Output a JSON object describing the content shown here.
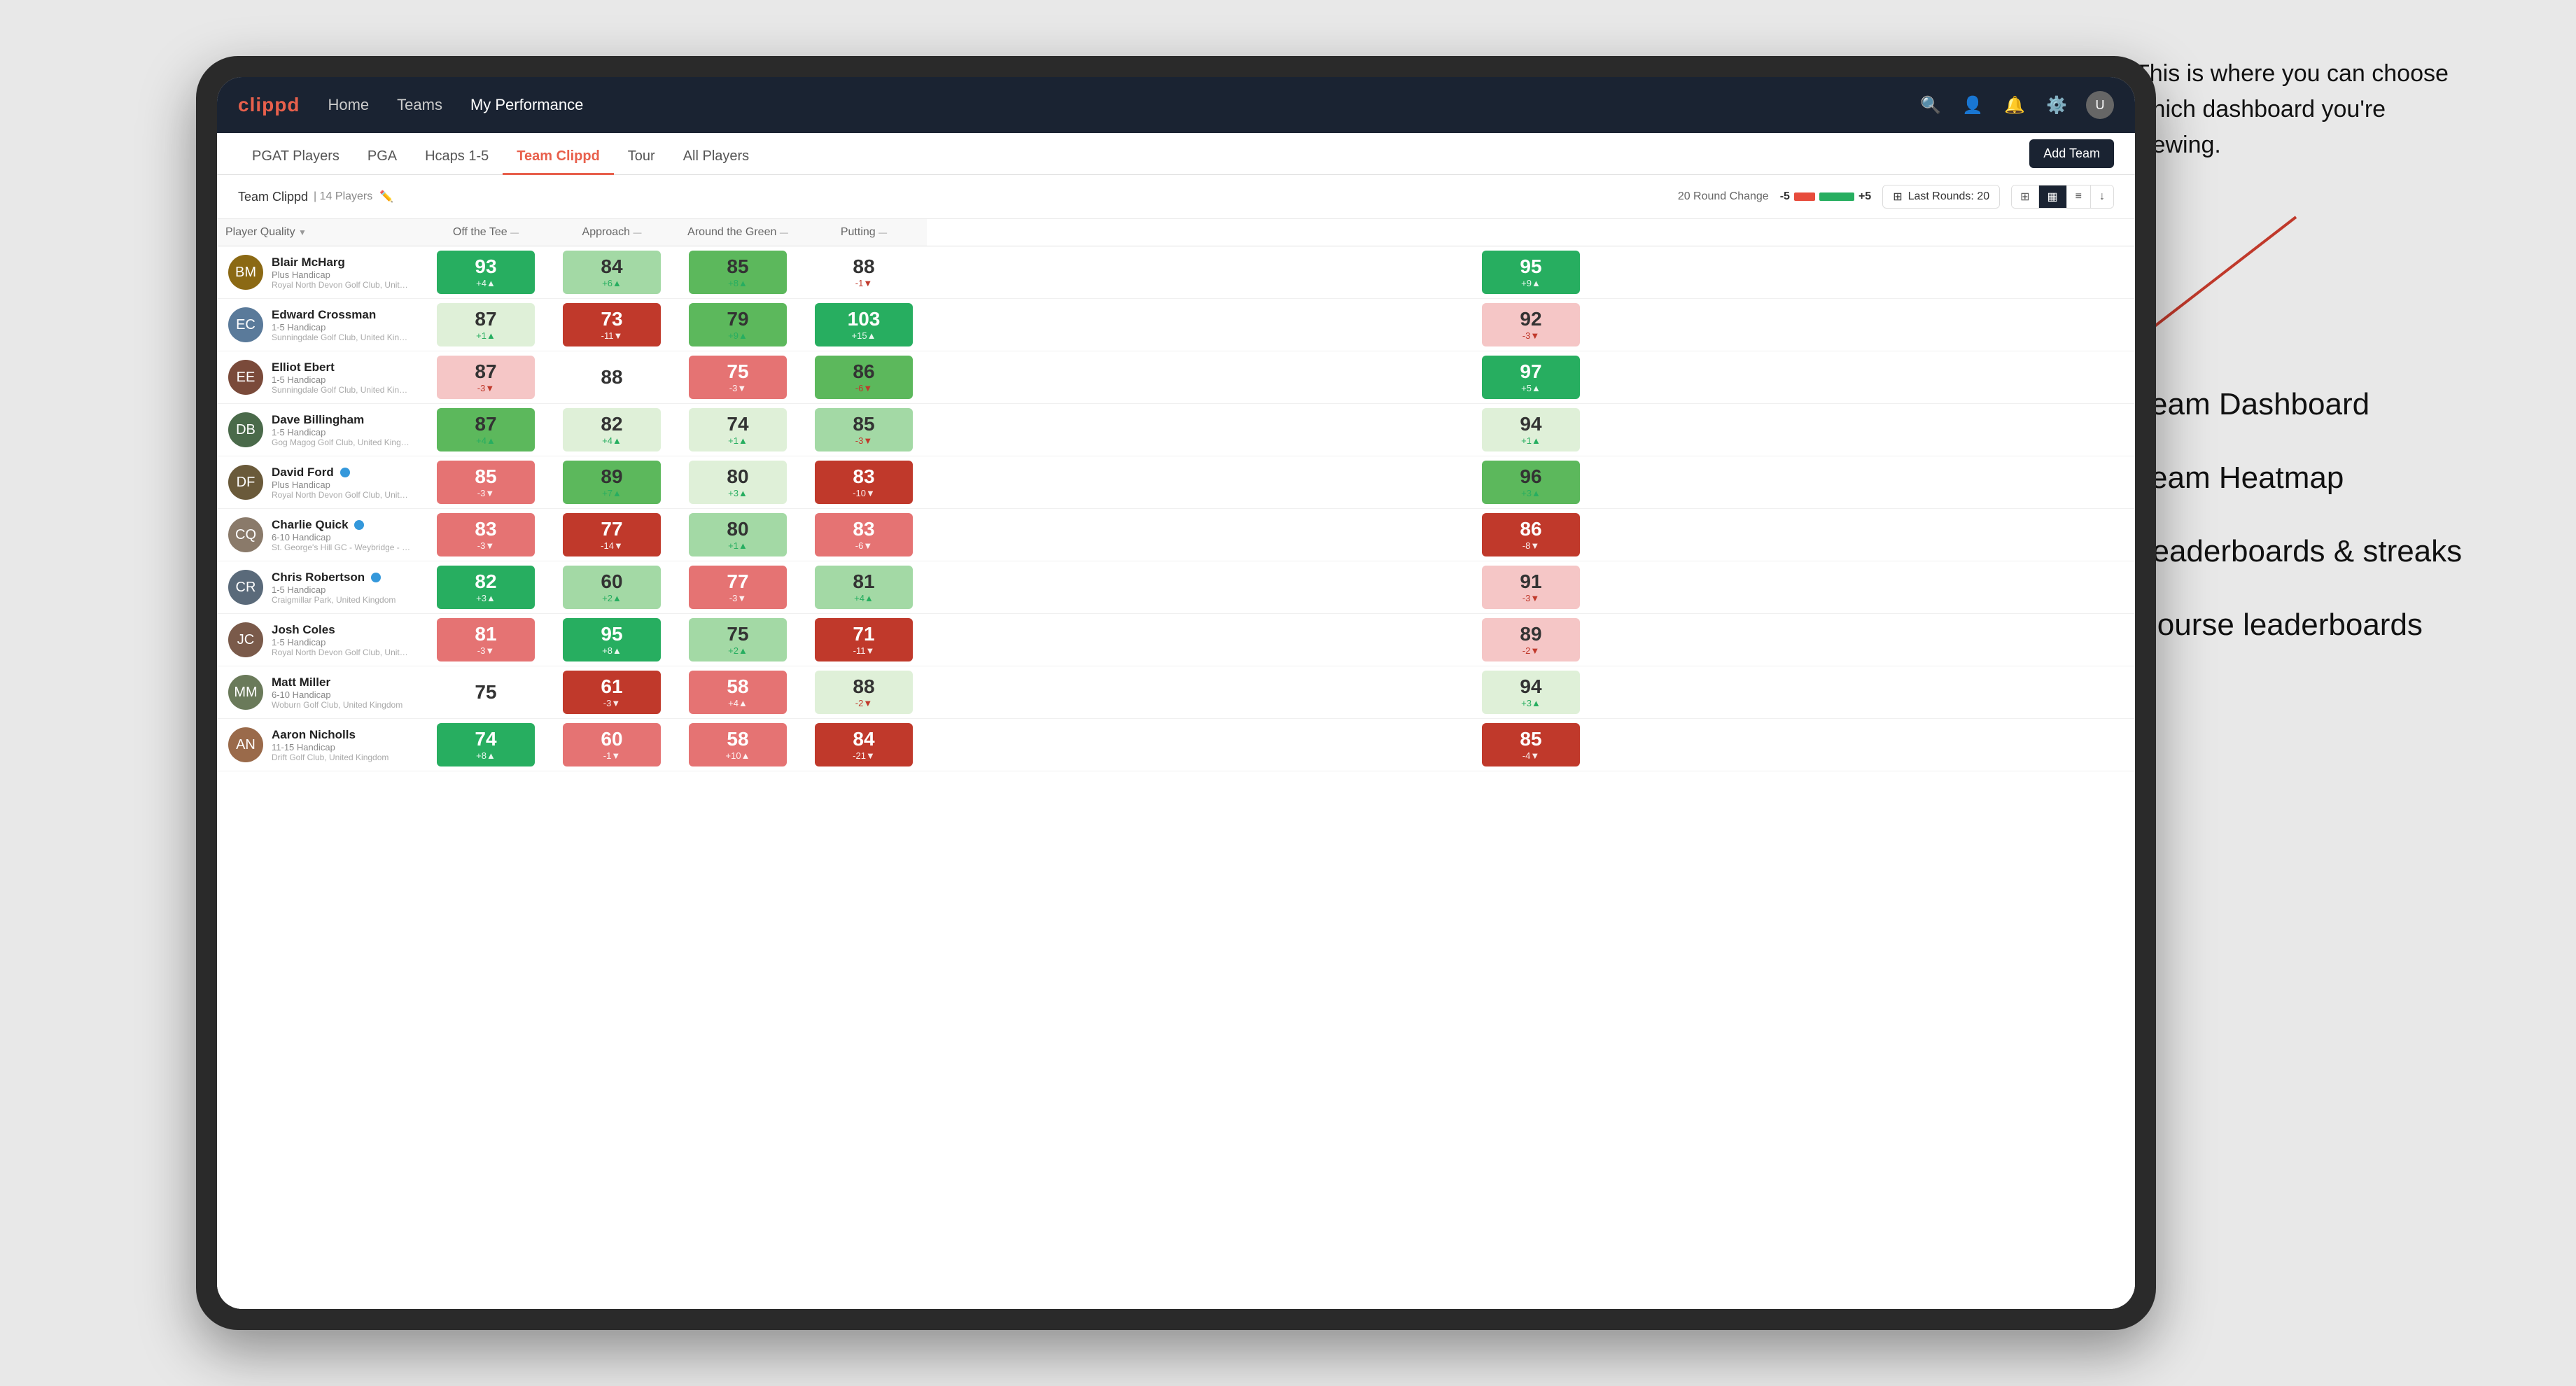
{
  "annotation": {
    "callout": "This is where you can choose which dashboard you're viewing.",
    "options": [
      "Team Dashboard",
      "Team Heatmap",
      "Leaderboards & streaks",
      "Course leaderboards"
    ]
  },
  "nav": {
    "logo": "clippd",
    "items": [
      "Home",
      "Teams",
      "My Performance"
    ],
    "active": "My Performance"
  },
  "secondary_nav": {
    "tabs": [
      "PGAT Players",
      "PGA",
      "Hcaps 1-5",
      "Team Clippd",
      "Tour",
      "All Players"
    ],
    "active": "Team Clippd",
    "add_button": "Add Team"
  },
  "team_bar": {
    "name": "Team Clippd",
    "separator": "|",
    "count": "14 Players",
    "round_change_label": "20 Round Change",
    "neg_label": "-5",
    "pos_label": "+5",
    "last_rounds_label": "Last Rounds:",
    "last_rounds_value": "20"
  },
  "table": {
    "columns": [
      {
        "label": "Player Quality",
        "key": "quality",
        "sortable": true
      },
      {
        "label": "Off the Tee",
        "key": "tee",
        "sortable": true
      },
      {
        "label": "Approach",
        "key": "approach",
        "sortable": true
      },
      {
        "label": "Around the Green",
        "key": "green",
        "sortable": true
      },
      {
        "label": "Putting",
        "key": "putting",
        "sortable": true
      }
    ],
    "rows": [
      {
        "name": "Blair McHarg",
        "handicap": "Plus Handicap",
        "club": "Royal North Devon Golf Club, United Kingdom",
        "avatar_color": "#8B6914",
        "initials": "BM",
        "verified": false,
        "quality": {
          "value": 93,
          "change": "+4",
          "dir": "up",
          "bg": "bg-dark-green",
          "dark": true
        },
        "tee": {
          "value": 84,
          "change": "+6",
          "dir": "up",
          "bg": "bg-light-green",
          "dark": false
        },
        "approach": {
          "value": 85,
          "change": "+8",
          "dir": "up",
          "bg": "bg-mid-green",
          "dark": false
        },
        "green": {
          "value": 88,
          "change": "-1",
          "dir": "dn",
          "bg": "bg-white",
          "dark": false
        },
        "putting": {
          "value": 95,
          "change": "+9",
          "dir": "up",
          "bg": "bg-dark-green",
          "dark": true
        }
      },
      {
        "name": "Edward Crossman",
        "handicap": "1-5 Handicap",
        "club": "Sunningdale Golf Club, United Kingdom",
        "avatar_color": "#5a7a9a",
        "initials": "EC",
        "verified": false,
        "quality": {
          "value": 87,
          "change": "+1",
          "dir": "up",
          "bg": "bg-very-light-green",
          "dark": false
        },
        "tee": {
          "value": 73,
          "change": "-11",
          "dir": "dn",
          "bg": "bg-dark-red",
          "dark": true
        },
        "approach": {
          "value": 79,
          "change": "+9",
          "dir": "up",
          "bg": "bg-mid-green",
          "dark": false
        },
        "green": {
          "value": 103,
          "change": "+15",
          "dir": "up",
          "bg": "bg-dark-green",
          "dark": true
        },
        "putting": {
          "value": 92,
          "change": "-3",
          "dir": "dn",
          "bg": "bg-light-red",
          "dark": false
        }
      },
      {
        "name": "Elliot Ebert",
        "handicap": "1-5 Handicap",
        "club": "Sunningdale Golf Club, United Kingdom",
        "avatar_color": "#7a4a3a",
        "initials": "EE",
        "verified": false,
        "quality": {
          "value": 87,
          "change": "-3",
          "dir": "dn",
          "bg": "bg-light-red",
          "dark": false
        },
        "tee": {
          "value": 88,
          "change": "",
          "dir": "",
          "bg": "bg-white",
          "dark": false
        },
        "approach": {
          "value": 75,
          "change": "-3",
          "dir": "dn",
          "bg": "bg-mid-red",
          "dark": false
        },
        "green": {
          "value": 86,
          "change": "-6",
          "dir": "dn",
          "bg": "bg-mid-green",
          "dark": false
        },
        "putting": {
          "value": 97,
          "change": "+5",
          "dir": "up",
          "bg": "bg-dark-green",
          "dark": true
        }
      },
      {
        "name": "Dave Billingham",
        "handicap": "1-5 Handicap",
        "club": "Gog Magog Golf Club, United Kingdom",
        "avatar_color": "#4a6a4a",
        "initials": "DB",
        "verified": false,
        "quality": {
          "value": 87,
          "change": "+4",
          "dir": "up",
          "bg": "bg-mid-green",
          "dark": false
        },
        "tee": {
          "value": 82,
          "change": "+4",
          "dir": "up",
          "bg": "bg-very-light-green",
          "dark": false
        },
        "approach": {
          "value": 74,
          "change": "+1",
          "dir": "up",
          "bg": "bg-very-light-green",
          "dark": false
        },
        "green": {
          "value": 85,
          "change": "-3",
          "dir": "dn",
          "bg": "bg-light-green",
          "dark": false
        },
        "putting": {
          "value": 94,
          "change": "+1",
          "dir": "up",
          "bg": "bg-very-light-green",
          "dark": false
        }
      },
      {
        "name": "David Ford",
        "handicap": "Plus Handicap",
        "club": "Royal North Devon Golf Club, United Kingdom",
        "avatar_color": "#6a5a3a",
        "initials": "DF",
        "verified": true,
        "quality": {
          "value": 85,
          "change": "-3",
          "dir": "dn",
          "bg": "bg-mid-red",
          "dark": false
        },
        "tee": {
          "value": 89,
          "change": "+7",
          "dir": "up",
          "bg": "bg-mid-green",
          "dark": false
        },
        "approach": {
          "value": 80,
          "change": "+3",
          "dir": "up",
          "bg": "bg-very-light-green",
          "dark": false
        },
        "green": {
          "value": 83,
          "change": "-10",
          "dir": "dn",
          "bg": "bg-dark-red",
          "dark": true
        },
        "putting": {
          "value": 96,
          "change": "+3",
          "dir": "up",
          "bg": "bg-mid-green",
          "dark": false
        }
      },
      {
        "name": "Charlie Quick",
        "handicap": "6-10 Handicap",
        "club": "St. George's Hill GC - Weybridge - Surrey, Uni...",
        "avatar_color": "#8a7a6a",
        "initials": "CQ",
        "verified": true,
        "quality": {
          "value": 83,
          "change": "-3",
          "dir": "dn",
          "bg": "bg-mid-red",
          "dark": false
        },
        "tee": {
          "value": 77,
          "change": "-14",
          "dir": "dn",
          "bg": "bg-dark-red",
          "dark": true
        },
        "approach": {
          "value": 80,
          "change": "+1",
          "dir": "up",
          "bg": "bg-light-green",
          "dark": false
        },
        "green": {
          "value": 83,
          "change": "-6",
          "dir": "dn",
          "bg": "bg-mid-red",
          "dark": false
        },
        "putting": {
          "value": 86,
          "change": "-8",
          "dir": "dn",
          "bg": "bg-dark-red",
          "dark": true
        }
      },
      {
        "name": "Chris Robertson",
        "handicap": "1-5 Handicap",
        "club": "Craigmillar Park, United Kingdom",
        "avatar_color": "#5a6a7a",
        "initials": "CR",
        "verified": true,
        "quality": {
          "value": 82,
          "change": "+3",
          "dir": "up",
          "bg": "bg-dark-green",
          "dark": true
        },
        "tee": {
          "value": 60,
          "change": "+2",
          "dir": "up",
          "bg": "bg-light-green",
          "dark": false
        },
        "approach": {
          "value": 77,
          "change": "-3",
          "dir": "dn",
          "bg": "bg-mid-red",
          "dark": false
        },
        "green": {
          "value": 81,
          "change": "+4",
          "dir": "up",
          "bg": "bg-light-green",
          "dark": false
        },
        "putting": {
          "value": 91,
          "change": "-3",
          "dir": "dn",
          "bg": "bg-light-red",
          "dark": false
        }
      },
      {
        "name": "Josh Coles",
        "handicap": "1-5 Handicap",
        "club": "Royal North Devon Golf Club, United Kingdom",
        "avatar_color": "#7a5a4a",
        "initials": "JC",
        "verified": false,
        "quality": {
          "value": 81,
          "change": "-3",
          "dir": "dn",
          "bg": "bg-mid-red",
          "dark": false
        },
        "tee": {
          "value": 95,
          "change": "+8",
          "dir": "up",
          "bg": "bg-dark-green",
          "dark": true
        },
        "approach": {
          "value": 75,
          "change": "+2",
          "dir": "up",
          "bg": "bg-light-green",
          "dark": false
        },
        "green": {
          "value": 71,
          "change": "-11",
          "dir": "dn",
          "bg": "bg-dark-red",
          "dark": true
        },
        "putting": {
          "value": 89,
          "change": "-2",
          "dir": "dn",
          "bg": "bg-light-red",
          "dark": false
        }
      },
      {
        "name": "Matt Miller",
        "handicap": "6-10 Handicap",
        "club": "Woburn Golf Club, United Kingdom",
        "avatar_color": "#6a7a5a",
        "initials": "MM",
        "verified": false,
        "quality": {
          "value": 75,
          "change": "",
          "dir": "",
          "bg": "bg-white",
          "dark": false
        },
        "tee": {
          "value": 61,
          "change": "-3",
          "dir": "dn",
          "bg": "bg-dark-red",
          "dark": true
        },
        "approach": {
          "value": 58,
          "change": "+4",
          "dir": "up",
          "bg": "bg-mid-red",
          "dark": false
        },
        "green": {
          "value": 88,
          "change": "-2",
          "dir": "dn",
          "bg": "bg-very-light-green",
          "dark": false
        },
        "putting": {
          "value": 94,
          "change": "+3",
          "dir": "up",
          "bg": "bg-very-light-green",
          "dark": false
        }
      },
      {
        "name": "Aaron Nicholls",
        "handicap": "11-15 Handicap",
        "club": "Drift Golf Club, United Kingdom",
        "avatar_color": "#9a6a4a",
        "initials": "AN",
        "verified": false,
        "quality": {
          "value": 74,
          "change": "+8",
          "dir": "up",
          "bg": "bg-dark-green",
          "dark": true
        },
        "tee": {
          "value": 60,
          "change": "-1",
          "dir": "dn",
          "bg": "bg-mid-red",
          "dark": false
        },
        "approach": {
          "value": 58,
          "change": "+10",
          "dir": "up",
          "bg": "bg-mid-red",
          "dark": false
        },
        "green": {
          "value": 84,
          "change": "-21",
          "dir": "dn",
          "bg": "bg-dark-red",
          "dark": true
        },
        "putting": {
          "value": 85,
          "change": "-4",
          "dir": "dn",
          "bg": "bg-dark-red",
          "dark": true
        }
      }
    ]
  }
}
